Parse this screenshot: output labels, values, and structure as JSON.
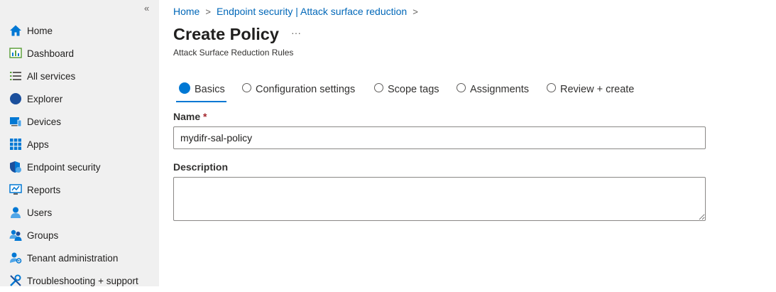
{
  "sidebar": {
    "collapse_glyph": "«",
    "items": [
      {
        "label": "Home",
        "icon": "home-icon"
      },
      {
        "label": "Dashboard",
        "icon": "dashboard-icon"
      },
      {
        "label": "All services",
        "icon": "list-icon"
      },
      {
        "label": "Explorer",
        "icon": "explorer-icon"
      },
      {
        "label": "Devices",
        "icon": "devices-icon"
      },
      {
        "label": "Apps",
        "icon": "apps-grid-icon"
      },
      {
        "label": "Endpoint security",
        "icon": "shield-icon"
      },
      {
        "label": "Reports",
        "icon": "reports-icon"
      },
      {
        "label": "Users",
        "icon": "user-icon"
      },
      {
        "label": "Groups",
        "icon": "group-icon"
      },
      {
        "label": "Tenant administration",
        "icon": "tenant-admin-icon"
      },
      {
        "label": "Troubleshooting + support",
        "icon": "wrench-icon"
      }
    ]
  },
  "breadcrumb": {
    "items": [
      "Home",
      "Endpoint security | Attack surface reduction"
    ],
    "separator": ">"
  },
  "header": {
    "title": "Create Policy",
    "more_glyph": "···",
    "subtitle": "Attack Surface Reduction Rules"
  },
  "tabs": [
    {
      "label": "Basics",
      "active": true
    },
    {
      "label": "Configuration settings",
      "active": false
    },
    {
      "label": "Scope tags",
      "active": false
    },
    {
      "label": "Assignments",
      "active": false
    },
    {
      "label": "Review + create",
      "active": false
    }
  ],
  "form": {
    "name_label": "Name",
    "required_marker": "*",
    "name_value": "mydifr-sal-policy",
    "description_label": "Description",
    "description_value": ""
  },
  "colors": {
    "accent": "#0078d4",
    "link": "#0067b8",
    "sidebar_bg": "#f0f0f0"
  }
}
